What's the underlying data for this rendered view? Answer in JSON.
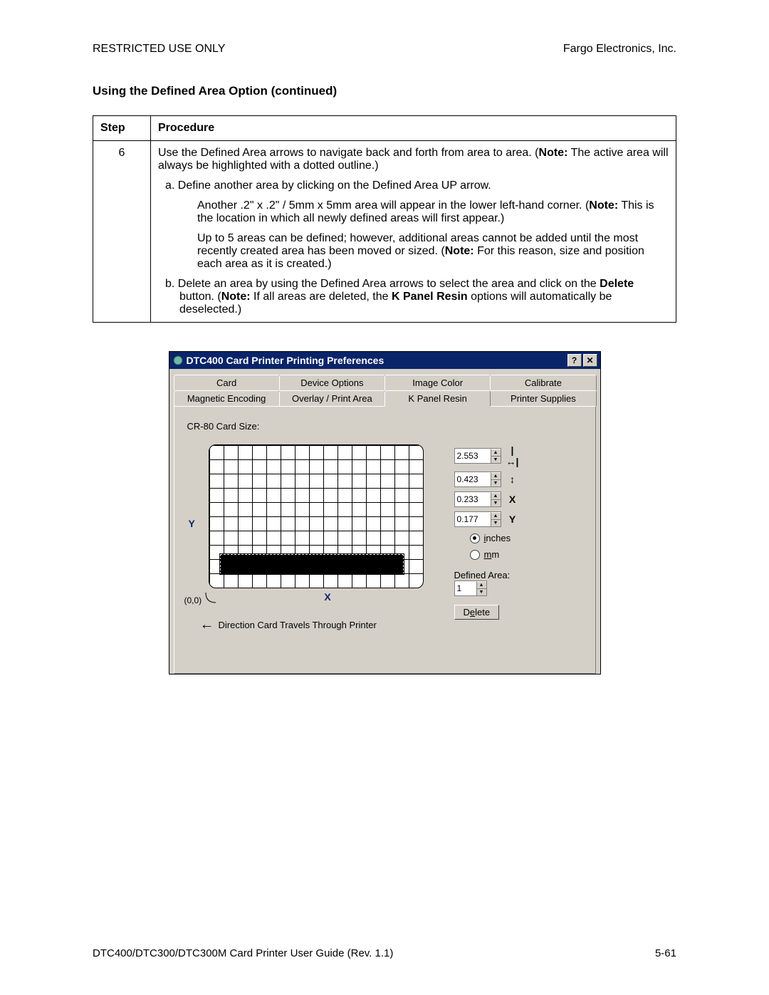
{
  "header": {
    "left": "RESTRICTED USE ONLY",
    "right": "Fargo Electronics, Inc."
  },
  "section_title": "Using the Defined Area Option (continued)",
  "table": {
    "head": {
      "step": "Step",
      "proc": "Procedure"
    },
    "step_num": "6",
    "p1a": "Use the Defined Area arrows to navigate back and forth from area to area. (",
    "p1note": "Note:",
    "p1b": "  The active area will always be highlighted with a dotted outline.)",
    "a_lead": "a.   Define another area by clicking on the Defined Area UP arrow.",
    "a_body1a": "Another .2\" x .2\" / 5mm x 5mm area will appear in the lower left-hand corner. (",
    "a_body1note": "Note:",
    "a_body1b": " This is the location in which all newly defined areas will first appear.)",
    "a_body2a": "Up to 5 areas can be defined; however, additional areas cannot be added until the most recently created area has been moved or sized. (",
    "a_body2note": "Note:",
    "a_body2b": " For this reason, size and position each area as it is created.)",
    "b_lead_a": "b.   Delete an area by using the Defined Area arrows to select the area and click on the ",
    "b_delete": "Delete",
    "b_lead_b": " button. (",
    "b_note": "Note:",
    "b_lead_c": "  If all areas are deleted, the ",
    "b_kpanel": "K Panel Resin",
    "b_lead_d": " options will automatically be deselected.)"
  },
  "dialog": {
    "title": "DTC400 Card Printer Printing Preferences",
    "help_btn": "?",
    "close_btn": "✕",
    "tabs_row1": [
      "Card",
      "Device Options",
      "Image Color",
      "Calibrate"
    ],
    "tabs_row2": [
      "Magnetic Encoding",
      "Overlay / Print Area",
      "K Panel Resin",
      "Printer Supplies"
    ],
    "cr_label": "CR-80 Card Size:",
    "y_label": "Y",
    "x_label": "X",
    "origin": "(0,0)",
    "direction": "Direction Card Travels Through Printer",
    "spins": {
      "width": {
        "value": "2.553",
        "icon": "↔"
      },
      "height": {
        "value": "0.423",
        "icon": "↕"
      },
      "x": {
        "value": "0.233",
        "icon": "X"
      },
      "y": {
        "value": "0.177",
        "icon": "Y"
      }
    },
    "units": {
      "inches_u": "i",
      "inches_rest": "nches",
      "mm_u": "m",
      "mm_rest": "m"
    },
    "defined_area_label": "Defined Area:",
    "defined_area_value": "1",
    "delete_u": "e",
    "delete_pre": "D",
    "delete_post": "lete"
  },
  "footer": {
    "left": "DTC400/DTC300/DTC300M Card Printer User Guide (Rev. 1.1)",
    "right": "5-61"
  }
}
